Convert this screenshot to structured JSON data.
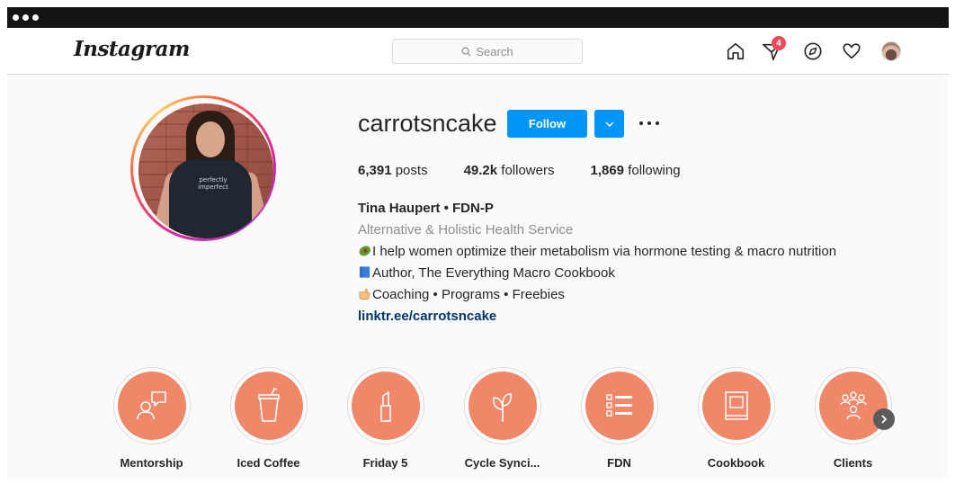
{
  "nav": {
    "logo": "Instagram",
    "search_placeholder": "Search",
    "notifications_badge": "4"
  },
  "profile": {
    "username": "carrotsncake",
    "follow_label": "Follow",
    "posts_count": "6,391",
    "posts_label": " posts",
    "followers_count": "49.2k",
    "followers_label": " followers",
    "following_count": "1,869",
    "following_label": " following",
    "display_name": "Tina Haupert • FDN-P",
    "category": "Alternative & Holistic Health Service",
    "bio_lines": [
      "I help women optimize their metabolism via hormone testing & macro nutrition",
      "Author, The Everything Macro Cookbook",
      "Coaching • Programs • Freebies"
    ],
    "link": "linktr.ee/carrotsncake",
    "photo_shirt_text": "perfectly imperfect"
  },
  "highlights": [
    {
      "label": "Mentorship",
      "icon": "mentorship-chat-icon"
    },
    {
      "label": "Iced Coffee",
      "icon": "iced-coffee-icon"
    },
    {
      "label": "Friday 5",
      "icon": "lipstick-icon"
    },
    {
      "label": "Cycle Synci...",
      "icon": "leaf-icon"
    },
    {
      "label": "FDN",
      "icon": "list-icon"
    },
    {
      "label": "Cookbook",
      "icon": "book-icon"
    },
    {
      "label": "Clients",
      "icon": "group-icon"
    }
  ],
  "colors": {
    "accent": "#0095f6",
    "highlight_fill": "#ef8768",
    "badge": "#ed4956",
    "link": "#00376b"
  }
}
